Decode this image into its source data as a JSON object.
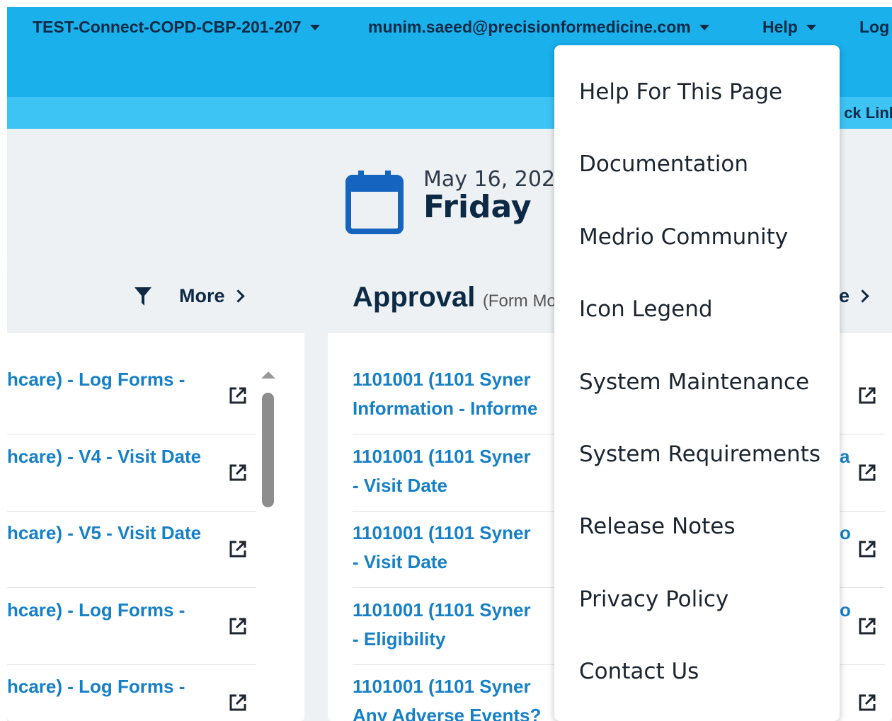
{
  "topbar": {
    "study": "TEST-Connect-COPD-CBP-201-207",
    "user": "munim.saeed@precisionformedicine.com",
    "help": "Help",
    "logout": "Log"
  },
  "quicklinks": {
    "label": "ck Link"
  },
  "date": {
    "date_text": "May 16, 202",
    "day": "Friday"
  },
  "left_panel": {
    "more_label": "More",
    "rows": [
      {
        "line1": "hcare) - Log Forms -",
        "line2": ""
      },
      {
        "line1": "hcare) - V4 - Visit Date",
        "line2": ""
      },
      {
        "line1": "hcare) - V5 - Visit Date",
        "line2": ""
      },
      {
        "line1": "hcare) - Log Forms -",
        "line2": ""
      },
      {
        "line1": "hcare) - Log Forms -",
        "line2": ""
      }
    ]
  },
  "approval_panel": {
    "title": "Approval",
    "subtitle": "(Form Mo",
    "more_label": "e",
    "rows": [
      {
        "line1": "1101001 (1101 Syner",
        "line2": "Information - Informe",
        "tail": ""
      },
      {
        "line1": "1101001 (1101 Syner",
        "line2": "- Visit Date",
        "tail": "a"
      },
      {
        "line1": "1101001 (1101 Syner",
        "line2": "- Visit Date",
        "tail": "o"
      },
      {
        "line1": "1101001 (1101 Syner",
        "line2": "- Eligibility",
        "tail": "o"
      },
      {
        "line1": "1101001 (1101 Syner",
        "line2": "Any Adverse Events?",
        "tail": ""
      }
    ]
  },
  "help_menu": {
    "items": [
      "Help For This Page",
      "Documentation",
      "Medrio Community",
      "Icon Legend",
      "System Maintenance",
      "System Requirements",
      "Release Notes",
      "Privacy Policy",
      "Contact Us"
    ]
  },
  "colors": {
    "topbar": "#1ab0ec",
    "quickbar": "#3ec3f5",
    "link": "#1680c7",
    "dark": "#0c2a45"
  }
}
